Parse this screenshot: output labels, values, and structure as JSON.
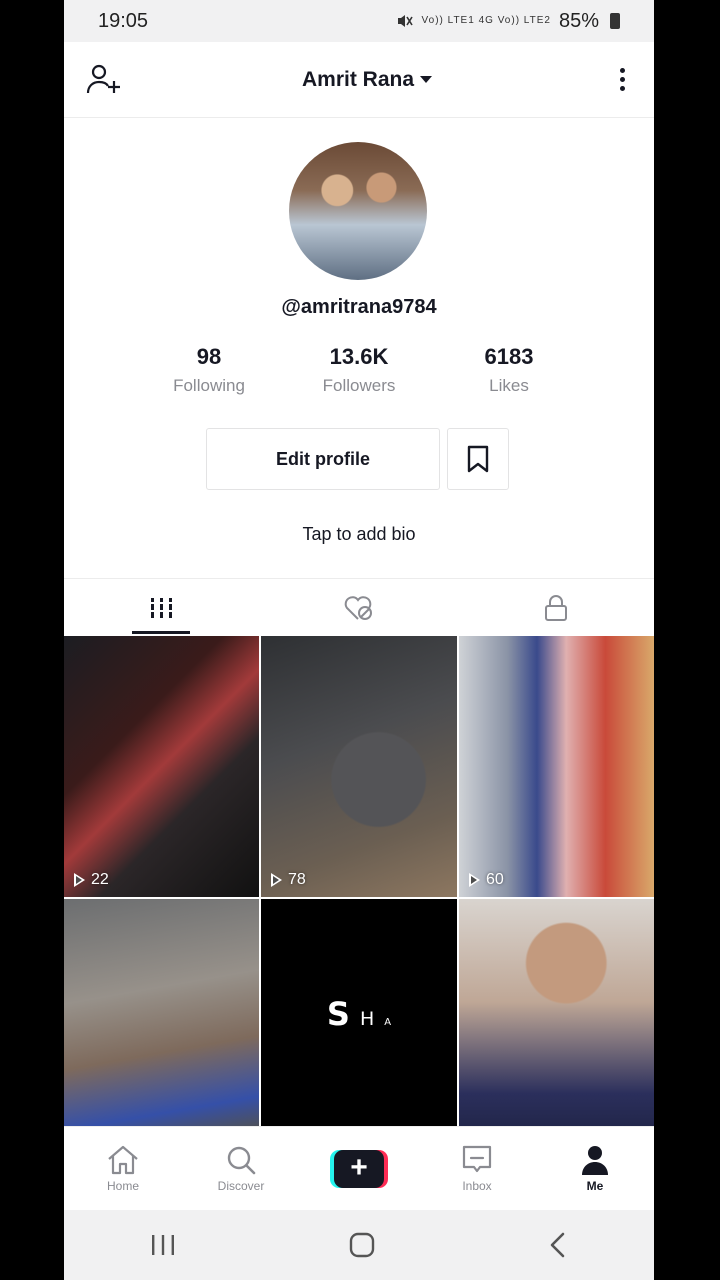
{
  "status_bar": {
    "time": "19:05",
    "network_labels": "Vo)) LTE1  4G  Vo)) LTE2",
    "battery": "85%"
  },
  "header": {
    "title": "Amrit Rana"
  },
  "profile": {
    "handle": "@amritrana9784",
    "stats": [
      {
        "value": "98",
        "label": "Following"
      },
      {
        "value": "13.6K",
        "label": "Followers"
      },
      {
        "value": "6183",
        "label": "Likes"
      }
    ],
    "edit_button": "Edit profile",
    "bio_prompt": "Tap to add bio"
  },
  "tabs": [
    "videos-grid-icon",
    "liked-hidden-icon",
    "private-lock-icon"
  ],
  "videos": [
    {
      "views": "22"
    },
    {
      "views": "78"
    },
    {
      "views": "60"
    },
    {
      "views": ""
    },
    {
      "views": "",
      "overlay_text": [
        "S",
        "H",
        "A"
      ]
    },
    {
      "views": ""
    }
  ],
  "bottom_nav": [
    {
      "label": "Home",
      "icon": "home-icon"
    },
    {
      "label": "Discover",
      "icon": "search-icon"
    },
    {
      "label": "",
      "icon": "plus-icon"
    },
    {
      "label": "Inbox",
      "icon": "inbox-icon"
    },
    {
      "label": "Me",
      "icon": "person-icon"
    }
  ],
  "colors": {
    "text": "#161823",
    "muted": "#8a8b91",
    "accent_cyan": "#25f4ee",
    "accent_red": "#fe2c55"
  }
}
